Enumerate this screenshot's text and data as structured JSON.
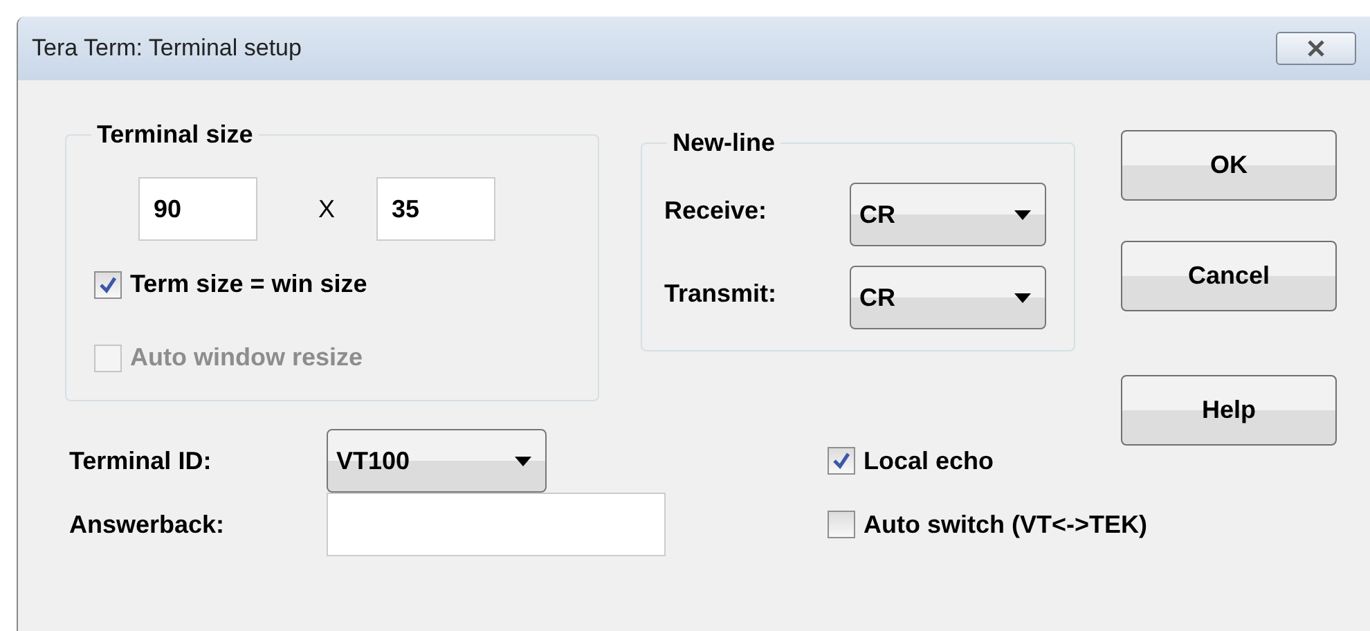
{
  "window": {
    "title": "Tera Term: Terminal setup"
  },
  "terminal_size": {
    "label": "Terminal size",
    "columns": "90",
    "separator": "X",
    "rows": "35",
    "options": [
      {
        "label": "Term size = win size",
        "checked": true,
        "disabled": false
      },
      {
        "label": "Auto window resize",
        "checked": false,
        "disabled": true
      }
    ]
  },
  "new_line": {
    "label": "New-line",
    "fields": [
      {
        "label": "Receive:",
        "value": "CR"
      },
      {
        "label": "Transmit:",
        "value": "CR"
      }
    ]
  },
  "buttons": [
    "OK",
    "Cancel",
    "Help"
  ],
  "terminal_id": {
    "label": "Terminal ID:",
    "value": "VT100"
  },
  "answerback": {
    "label": "Answerback:"
  },
  "options": [
    {
      "label": "Local echo",
      "checked": true
    },
    {
      "label": "Auto switch (VT<->TEK)",
      "checked": false
    }
  ]
}
